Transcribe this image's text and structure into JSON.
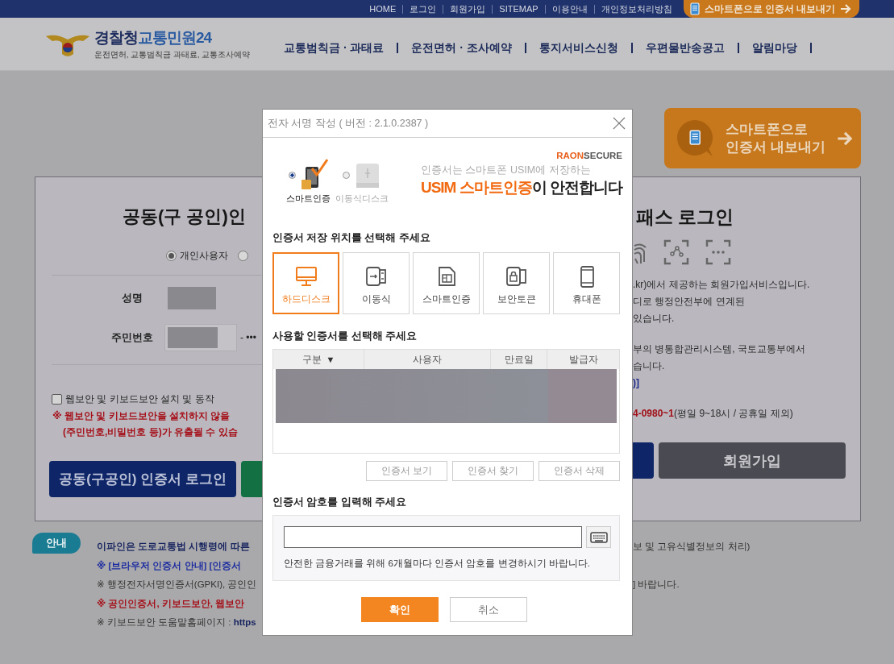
{
  "top_links": [
    "HOME",
    "로그인",
    "회원가입",
    "SITEMAP",
    "이용안내",
    "개인정보처리방침"
  ],
  "top_export_button": "스마트폰으로 인증서 내보내기",
  "logo": {
    "main": "경찰청",
    "sub": "교통민원24",
    "tagline": "운전면허, 교통범칙금 과태료, 교통조사예약"
  },
  "nav": [
    "교통범칙금 · 과태료",
    "운전면허 · 조사예약",
    "통지서비스신청",
    "우편물반송공고",
    "알림마당"
  ],
  "export_banner": {
    "line1": "스마트폰으로",
    "line2": "인증서 내보내기"
  },
  "left_panel": {
    "title": "공동(구 공인)인",
    "user_types": [
      {
        "label": "개인사용자",
        "selected": true
      },
      {
        "selected": false
      }
    ],
    "fields": [
      {
        "label": "성명"
      },
      {
        "label": "주민번호",
        "suffix": "- •••"
      }
    ],
    "security_check": {
      "label": "웹보안 및 키보드보안 설치 및 동작",
      "checked": false
    },
    "warning": [
      "※ 웹보안 및 키보드보안을 설치하지 않을",
      "(주민번호,비밀번호 등)가 유출될 수 있습"
    ],
    "login_button": "공동(구공인) 인증서 로그인"
  },
  "right_panel": {
    "title": "패스 로그인",
    "paragraphs": [
      [
        {
          "kind": "plain",
          "text": ".kr)에서 제공하는 회원가입서비스입니다."
        },
        {
          "kind": "plain",
          "text": "디로 행정안전부에 연계된"
        },
        {
          "kind": "plain",
          "text": "있습니다."
        }
      ],
      [
        {
          "kind": "plain",
          "text": "부의 병통합관리시스템, 국토교통부에서"
        },
        {
          "kind": "plain",
          "text": "습니다."
        },
        {
          "kind": "link",
          "text": ")]"
        }
      ],
      [
        {
          "kind": "phone",
          "text": "**4-0980~1**(평일 9~18시 / 공휴일 제외)"
        }
      ]
    ],
    "signup_button": "회원가입"
  },
  "notice": {
    "badge": "안내",
    "lines": [
      {
        "kind": "lead",
        "text": "이파인은 도로교통법 시행령에 따른",
        "right": "보 및 고유식별정보의 처리)"
      },
      {
        "kind": "link",
        "text": "※ [브라우저 인증서 안내] [인증서"
      },
      {
        "kind": "plain",
        "text": "※ 행정전자서명인증서(GPKI), 공인인",
        "right": "] 바랍니다."
      },
      {
        "kind": "warning",
        "text": "※ 공인인증서, 키보드보안, 웹보안"
      },
      {
        "kind": "plain",
        "text": "※ 키보드보안 도움말홈페이지 : **https**"
      }
    ]
  },
  "dialog": {
    "title": "전자 서명 작성 ( 버전 : 2.1.0.2387 )",
    "media": [
      {
        "kind": "smart",
        "label": "스마트인증",
        "selected": true
      },
      {
        "kind": "disk",
        "label": "이동식디스크",
        "selected": false
      }
    ],
    "brand": {
      "accent": "RAON",
      "rest": "SECURE"
    },
    "promo_line": "인증서는 스마트폰 USIM에 저장하는",
    "promo_highlight": "USIM 스마트인증",
    "promo_rest": "이 안전합니다",
    "storage_heading": "인증서 저장 위치를 선택해 주세요",
    "storage": [
      {
        "kind": "harddisk",
        "label": "하드디스크",
        "selected": true
      },
      {
        "kind": "removable",
        "label": "이동식",
        "selected": false
      },
      {
        "kind": "smart",
        "label": "스마트인증",
        "selected": false
      },
      {
        "kind": "token",
        "label": "보안토큰",
        "selected": false
      },
      {
        "kind": "phone",
        "label": "휴대폰",
        "selected": false
      }
    ],
    "cert_heading": "사용할 인증서를 선택해 주세요",
    "columns": [
      {
        "label": "구분",
        "sort_mark": "▼"
      },
      {
        "label": "사용자"
      },
      {
        "label": "만료일"
      },
      {
        "label": "발급자"
      }
    ],
    "rows": [
      {
        "kind": "redacted"
      }
    ],
    "cert_buttons": [
      "인증서 보기",
      "인증서 찾기",
      "인증서 삭제"
    ],
    "password_heading": "인증서 암호를 입력해 주세요",
    "password_hint": "안전한 금융거래를 위해 6개월마다 인증서 암호를 변경하시기 바랍니다.",
    "ok": "확인",
    "cancel": "취소"
  }
}
